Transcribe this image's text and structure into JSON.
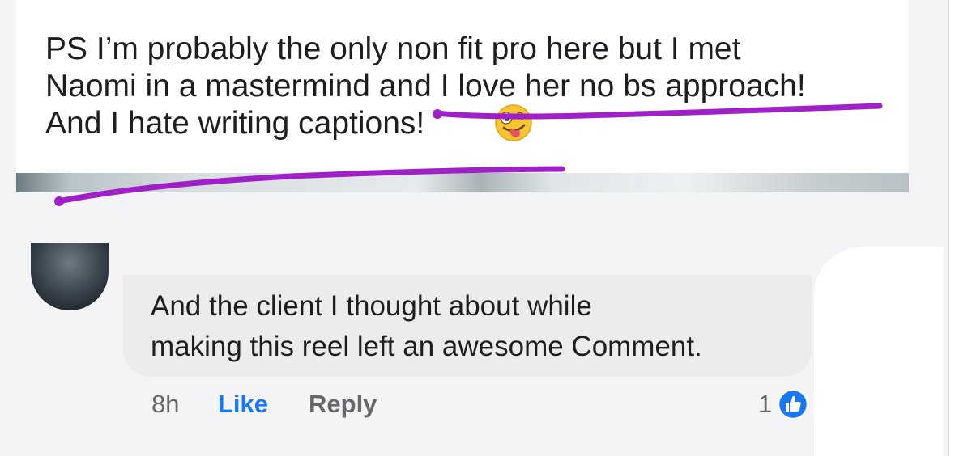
{
  "post": {
    "caption": "PS I’m probably the only non fit pro here but I met\nNaomi in a mastermind and I love her no bs approach!\nAnd I hate writing captions!",
    "emoji": "zany-face-emoji"
  },
  "comment": {
    "text": "And the client  I thought about while\nmaking this reel left an awesome Comment.",
    "time": "8h",
    "like_label": "Like",
    "reply_label": "Reply",
    "reaction_count": "1",
    "reaction_icon": "thumbs-up-icon"
  },
  "annotation": {
    "color": "#a020c8"
  },
  "colors": {
    "like_blue": "#1877f2",
    "muted": "#65676b",
    "bubble": "#ececee"
  }
}
